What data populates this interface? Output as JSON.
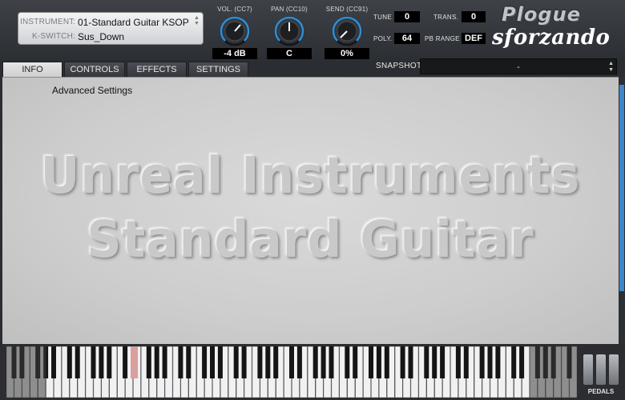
{
  "header": {
    "instrument_label": "INSTRUMENT",
    "instrument_value": "01-Standard Guitar KSOP",
    "kswitch_label": "K-SWITCH",
    "kswitch_value": "Sus_Down",
    "knobs": [
      {
        "label": "VOL. (CC7)",
        "value": "-4 dB"
      },
      {
        "label": "PAN (CC10)",
        "value": "C"
      },
      {
        "label": "SEND (CC91)",
        "value": "0%"
      }
    ],
    "tune_label": "TUNE",
    "tune_value": "0",
    "poly_label": "POLY.",
    "poly_value": "64",
    "trans_label": "TRANS.",
    "trans_value": "0",
    "pbrange_label": "PB RANGE",
    "pbrange_value": "DEF",
    "logo_top": "Plogue",
    "logo_bottom": "sforzando"
  },
  "tabs": [
    {
      "label": "INFO",
      "active": true
    },
    {
      "label": "CONTROLS",
      "active": false
    },
    {
      "label": "EFFECTS",
      "active": false
    },
    {
      "label": "SETTINGS",
      "active": false
    }
  ],
  "snapshot": {
    "label": "SNAPSHOT",
    "value": "-"
  },
  "content": {
    "advanced_settings": "Advanced Settings",
    "line1": "Unreal Instruments",
    "line2": "Standard Guitar"
  },
  "pedals_label": "PEDALS",
  "colors": {
    "accent_blue": "#3d87c9",
    "highlight_key": "#d9a0a0",
    "knob_ring": "#2f8fd8"
  },
  "icons": {
    "instrument_arrows": "updown-arrows-icon",
    "snapshot_arrows": "updown-arrows-icon"
  }
}
